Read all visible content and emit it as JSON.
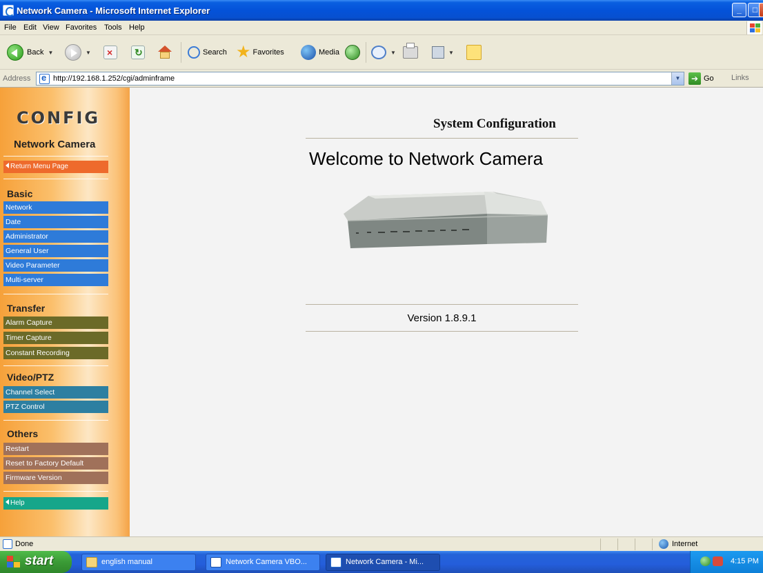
{
  "window": {
    "title": "Network Camera - Microsoft Internet Explorer",
    "controls": {
      "minimize": "_",
      "maximize": "□",
      "close": "X"
    }
  },
  "menu": [
    "File",
    "Edit",
    "View",
    "Favorites",
    "Tools",
    "Help"
  ],
  "toolbar": {
    "back": "Back",
    "search": "Search",
    "favorites": "Favorites",
    "media": "Media"
  },
  "address": {
    "label": "Address",
    "url": "http://192.168.1.252/cgi/adminframe",
    "go": "Go",
    "links": "Links"
  },
  "sidebar": {
    "title": "CONFIG",
    "subtitle": "Network Camera",
    "return": "Return Menu Page",
    "sections": [
      {
        "title": "Basic",
        "items": [
          "Network",
          "Date",
          "Administrator",
          "General User",
          "Video Parameter",
          "Multi-server"
        ]
      },
      {
        "title": "Transfer",
        "items": [
          "Alarm Capture",
          "Timer Capture",
          "Constant Recording"
        ]
      },
      {
        "title": "Video/PTZ",
        "items": [
          "Channel Select",
          "PTZ Control"
        ]
      },
      {
        "title": "Others",
        "items": [
          "Restart",
          "Reset to Factory Default",
          "Firmware Version"
        ]
      }
    ],
    "help": "Help"
  },
  "main": {
    "system_title": "System Configuration",
    "welcome": "Welcome to Network Camera",
    "version": "Version 1.8.9.1"
  },
  "status": {
    "text": "Done",
    "zone": "Internet"
  },
  "taskbar": {
    "start": "start",
    "tasks": [
      "english manual",
      "Network Camera VBO...",
      "Network Camera - Mi..."
    ],
    "clock": "4:15 PM"
  },
  "colors": {
    "titlebar": "#0452d9",
    "sidebar_orange": "#f6a13a",
    "nav_blue": "#2e7bd9",
    "nav_olive": "#6b6a28",
    "nav_teal": "#2d7fa1",
    "nav_brown": "#a0715a",
    "help_green": "#16a68a",
    "return_orange": "#ee6a2c",
    "content_bg": "#f3f3f3"
  }
}
